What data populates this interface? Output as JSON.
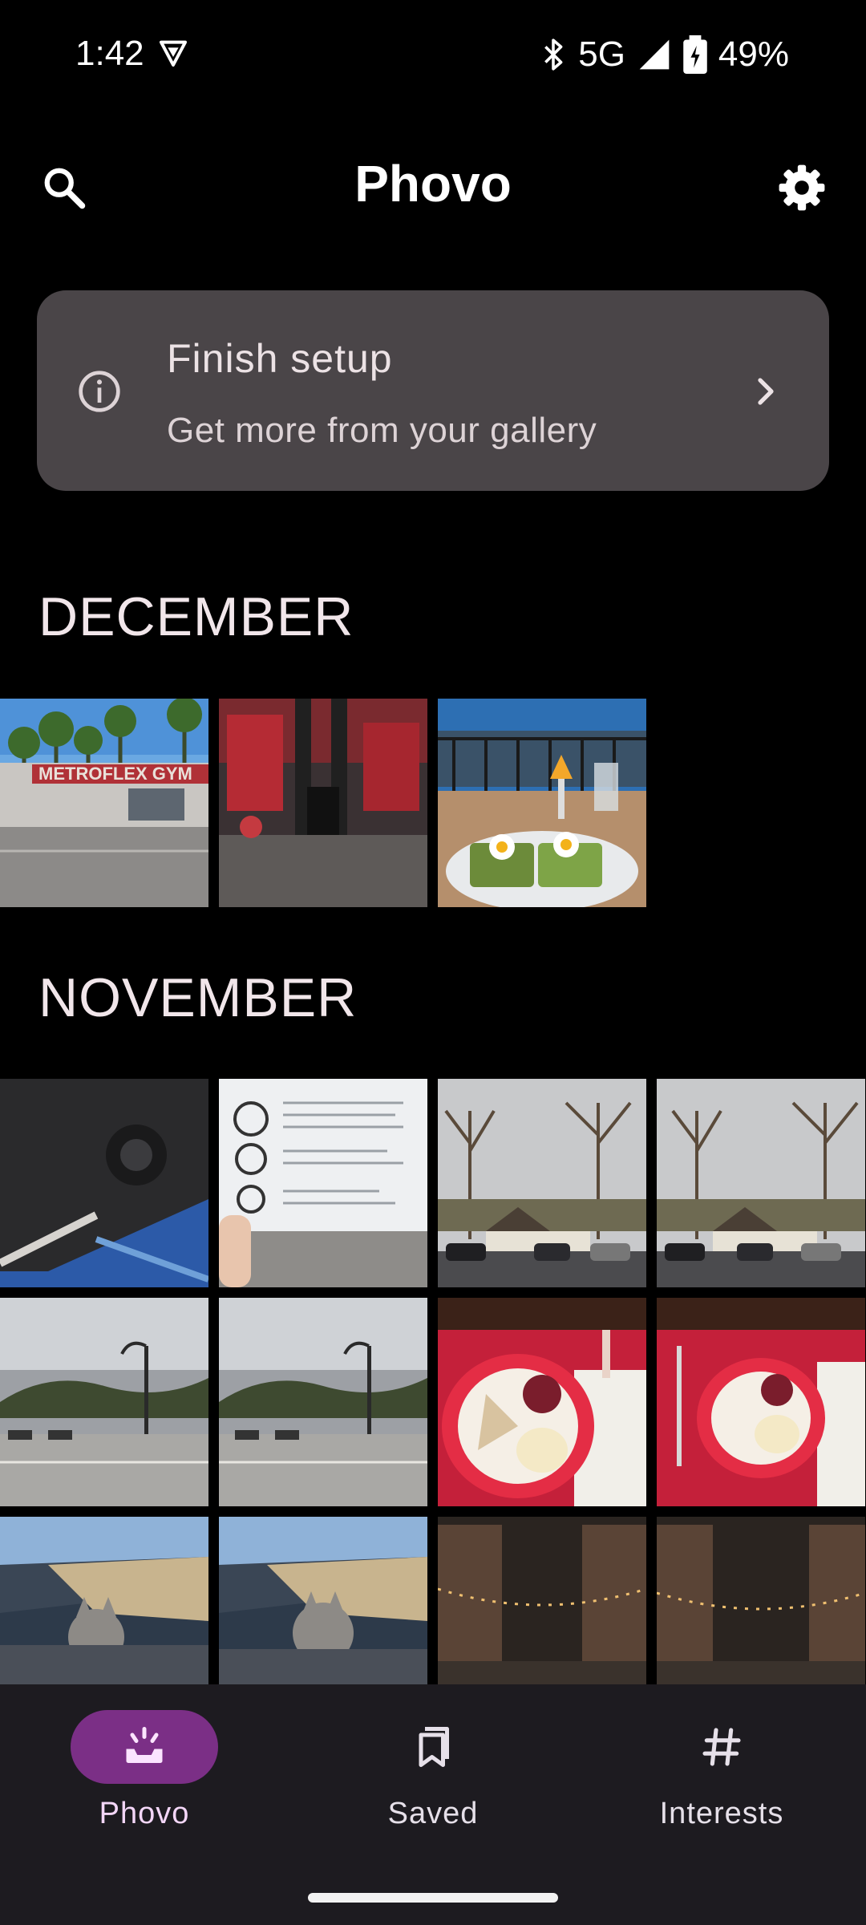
{
  "status_bar": {
    "time": "1:42",
    "network": "5G",
    "battery": "49%"
  },
  "app_bar": {
    "title": "Phovo",
    "search_icon": "search-icon",
    "settings_icon": "gear-icon"
  },
  "setup_card": {
    "title": "Finish setup",
    "subtitle": "Get more from your gallery",
    "icon": "info-icon"
  },
  "sections": [
    {
      "label": "DECEMBER",
      "photos": [
        "gym-exterior",
        "gym-interior",
        "brunch-table"
      ]
    },
    {
      "label": "NOVEMBER",
      "photos": [
        "car-part",
        "document",
        "trees-lodge",
        "trees-lodge",
        "street-lamp",
        "street-lamp",
        "dinner-plate",
        "dinner-plate",
        "cat-in-car",
        "cat-in-car",
        "night-courtyard",
        "night-courtyard"
      ]
    }
  ],
  "bottom_nav": {
    "items": [
      {
        "label": "Phovo",
        "icon": "photos-icon",
        "active": true
      },
      {
        "label": "Saved",
        "icon": "bookmark-icon",
        "active": false
      },
      {
        "label": "Interests",
        "icon": "hashtag-icon",
        "active": false
      }
    ]
  },
  "colors": {
    "background": "#000000",
    "card": "#4a4548",
    "active_pill": "#7b2f86",
    "nav_background": "#1d1b20"
  }
}
